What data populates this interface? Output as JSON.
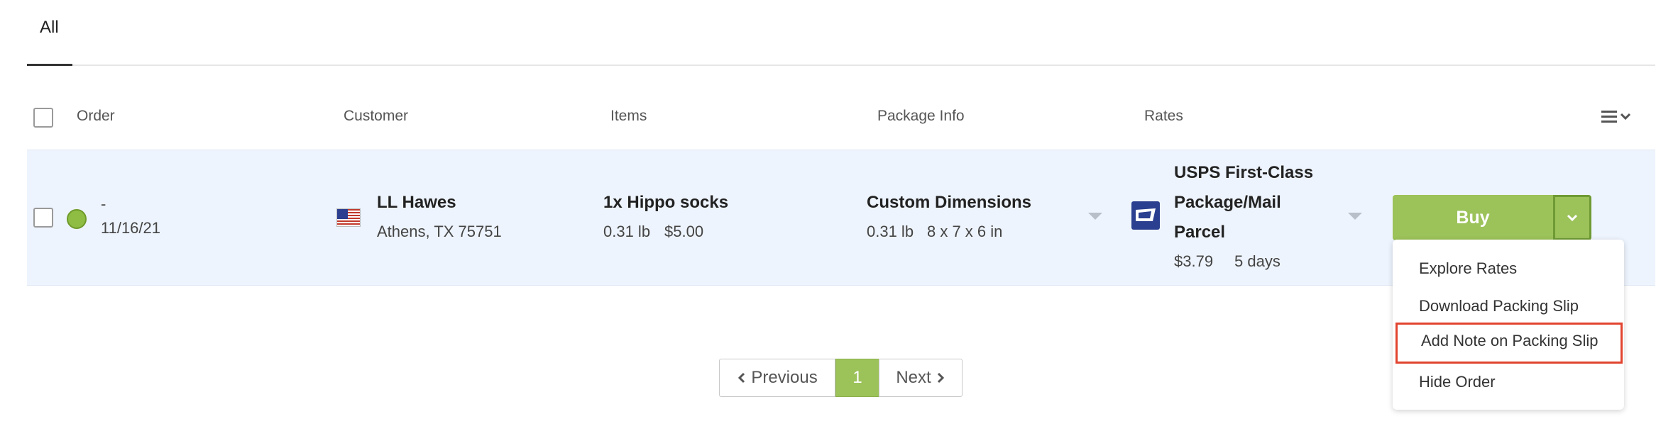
{
  "tabs": {
    "all": "All"
  },
  "table": {
    "headers": {
      "order": "Order",
      "customer": "Customer",
      "items": "Items",
      "package_info": "Package Info",
      "rates": "Rates"
    },
    "column_menu_icon": "list-chevron-icon"
  },
  "row": {
    "order_number": "-",
    "order_date": "11/16/21",
    "status_color": "#8fbd44",
    "customer_name": "LL Hawes",
    "customer_location": "Athens, TX 75751",
    "item_title": "1x Hippo socks",
    "item_weight": "0.31 lb",
    "item_price": "$5.00",
    "package_title": "Custom Dimensions",
    "package_weight": "0.31 lb",
    "package_dims": "8 x 7 x 6 in",
    "rate_line1": "USPS First-Class",
    "rate_line2": "Package/Mail",
    "rate_line3": "Parcel",
    "rate_price": "$3.79",
    "rate_days": "5 days",
    "buy_label": "Buy"
  },
  "menu": {
    "items": [
      "Explore Rates",
      "Download Packing Slip",
      "Add Note on Packing Slip",
      "Hide Order"
    ]
  },
  "pagination": {
    "previous": "Previous",
    "current": "1",
    "next": "Next"
  },
  "colors": {
    "accent": "#9cc25a",
    "highlight": "#e2442f",
    "row_bg": "#eef4fd"
  }
}
